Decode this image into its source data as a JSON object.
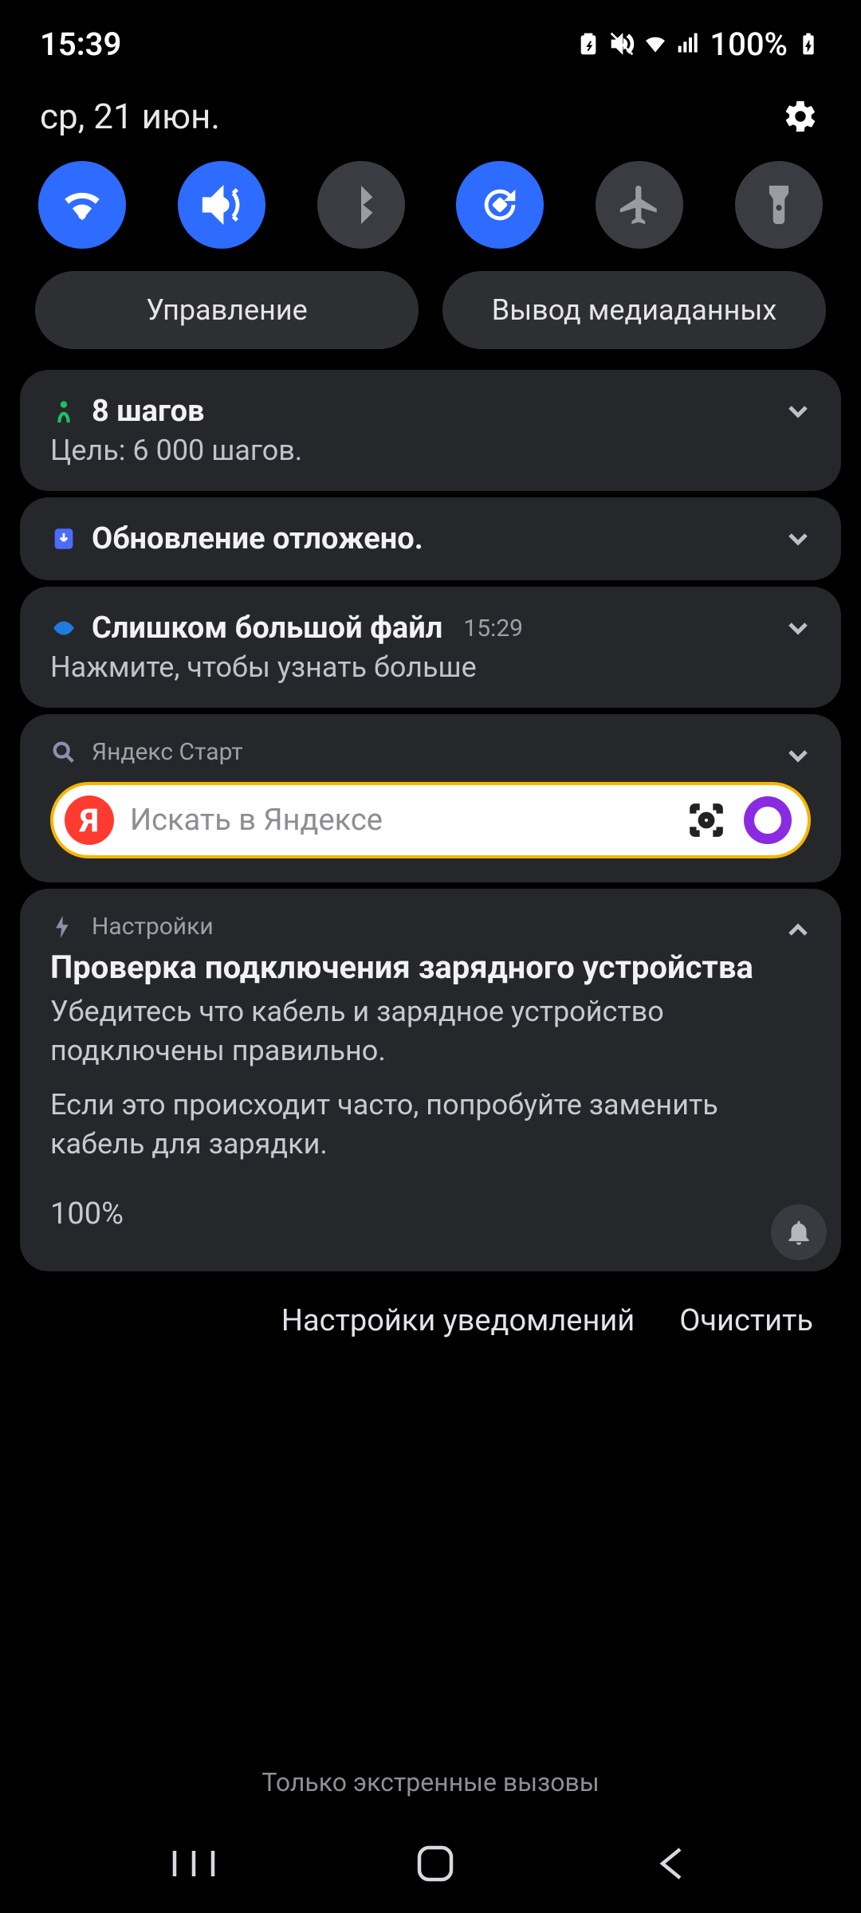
{
  "status": {
    "time": "15:39",
    "battery_text": "100%",
    "icons": [
      "battery-saver",
      "mute-vibrate",
      "wifi",
      "signal",
      "charging"
    ]
  },
  "header": {
    "date": "ср, 21 июн."
  },
  "quick_settings": {
    "tiles": [
      {
        "id": "wifi",
        "on": true
      },
      {
        "id": "mute",
        "on": true
      },
      {
        "id": "bluetooth",
        "on": false
      },
      {
        "id": "rotate",
        "on": true
      },
      {
        "id": "airplane",
        "on": false
      },
      {
        "id": "flashlight",
        "on": false
      }
    ],
    "buttons": [
      {
        "id": "devices",
        "label": "Управление"
      },
      {
        "id": "media",
        "label": "Вывод медиаданных"
      }
    ]
  },
  "notifications": [
    {
      "id": "health",
      "app_icon": "shealth",
      "title": "8 шагов",
      "subtitle": "Цель: 6 000 шагов.",
      "expandable": true,
      "expanded": false
    },
    {
      "id": "update",
      "app_icon": "system-update",
      "title": "Обновление отложено.",
      "expandable": true,
      "expanded": false
    },
    {
      "id": "send",
      "app_icon": "send-anywhere",
      "title": "Слишком большой файл",
      "time": "15:29",
      "subtitle": "Нажмите, чтобы узнать больше",
      "expandable": true,
      "expanded": false
    },
    {
      "id": "yandex",
      "app_icon": "search",
      "app_name": "Яндекс Старт",
      "search_placeholder": "Искать в Яндексе",
      "y_logo_letter": "Я",
      "expandable": true,
      "expanded": false
    },
    {
      "id": "settings",
      "app_icon": "bolt",
      "app_name": "Настройки",
      "title": "Проверка подключения зарядного устройства",
      "line1": "Убедитесь что кабель и зарядное устройство подключены правильно.",
      "line2": "Если это происходит часто, попробуйте заменить кабель для зарядки.",
      "percent": "100%",
      "expandable": true,
      "expanded": true
    }
  ],
  "footer": {
    "settings_label": "Настройки уведомлений",
    "clear_label": "Очистить"
  },
  "emergency_text": "Только экстренные вызовы"
}
